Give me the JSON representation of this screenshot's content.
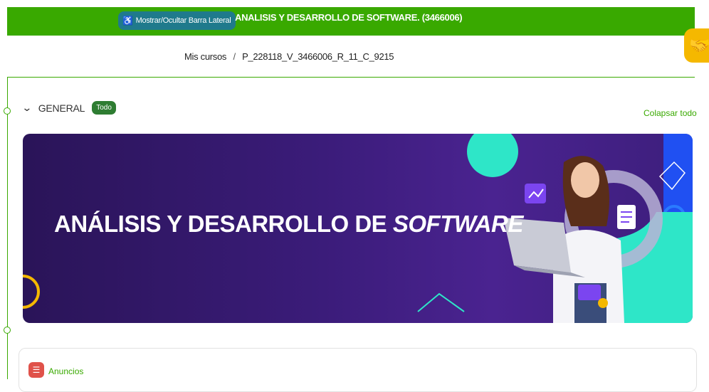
{
  "header": {
    "toggle_label": "Mostrar/Ocultar Barra Lateral",
    "course_title": "ANALISIS Y DESARROLLO DE SOFTWARE. (3466006)"
  },
  "breadcrumb": {
    "parent": "Mis cursos",
    "separator": "/",
    "current": "P_228118_V_3466006_R_11_C_9215"
  },
  "section": {
    "name": "GENERAL",
    "badge": "Todo",
    "collapse_all": "Colapsar todo"
  },
  "banner": {
    "title_main": "ANÁLISIS Y DESARROLLO DE ",
    "title_italic": "SOFTWARE"
  },
  "activity": {
    "label": "Anuncios"
  },
  "colors": {
    "brand_green": "#39a900",
    "banner_purple": "#3b1c7a",
    "accent_teal": "#2ee6c8",
    "helper_yellow": "#f5b800"
  }
}
